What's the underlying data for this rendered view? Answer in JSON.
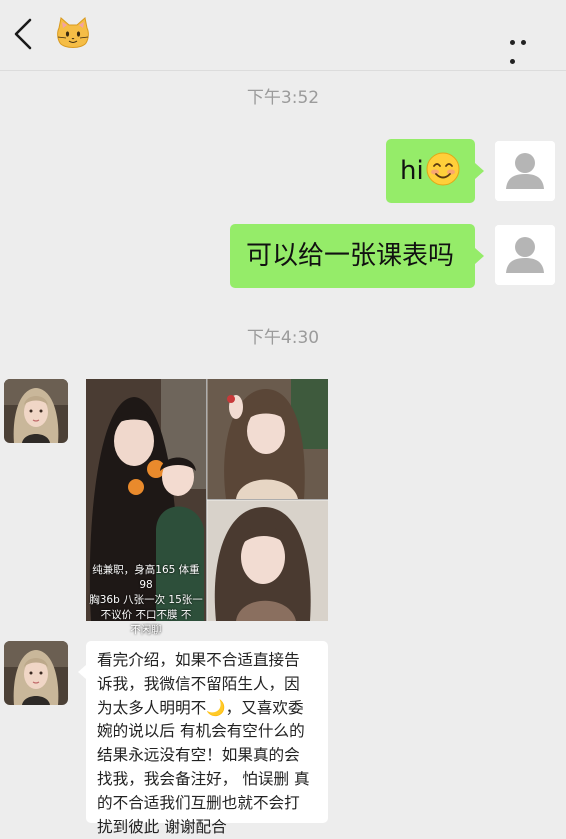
{
  "header": {
    "back_icon": "chevron-left-icon",
    "contact_icon": "cat-emoji-icon",
    "more_icon": "more-dots-icon"
  },
  "messages": {
    "time_1": "下午3:52",
    "out_1_text": "hi",
    "out_1_emoji": "smiling-face-icon",
    "out_2_text": "可以给一张课表吗",
    "time_2": "下午4:30",
    "image_caption": [
      "纯兼职，身高165 体重98",
      "胸36b 八张一次 15张一",
      "不议价 不口不膜 不",
      "不闲聊"
    ],
    "incoming_text": [
      "看完介绍，如果不合适直接告",
      "诉我，我微信不留陌生人，因",
      "为太多人明明不",
      "，又喜欢委",
      "婉的说以后 有机会有空什么的",
      "结果永远没有空！如果真的会",
      "找我，我会备注好， 怕误删 真",
      "的不合适我们互删也就不会打",
      "扰到彼此 谢谢配合"
    ],
    "moon_emoji": "🌙"
  },
  "colors": {
    "background": "#ededed",
    "bubble_out": "#95ec69",
    "bubble_in": "#ffffff",
    "timestamp": "#9b9b9b"
  }
}
